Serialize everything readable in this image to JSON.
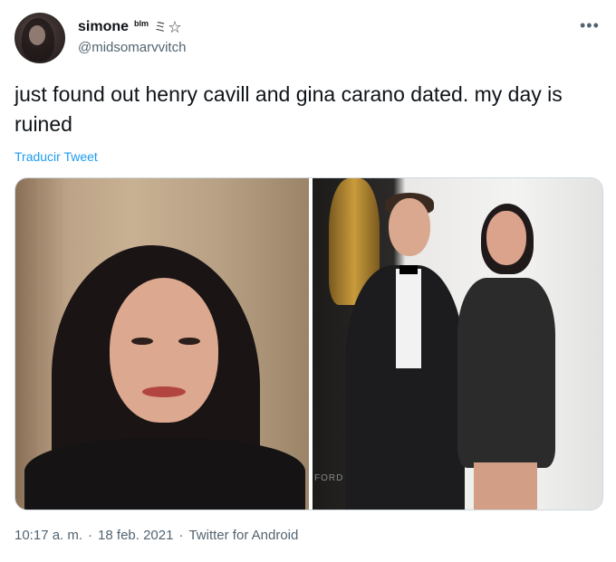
{
  "tweet": {
    "display_name": "simone",
    "name_extra": "blm",
    "name_emoji": "ミ☆",
    "handle": "@midsomarvvitch",
    "more_icon": "more-icon",
    "text": "just found out henry cavill and gina carano dated. my day is ruined",
    "translate_label": "Traducir Tweet",
    "time": "10:17 a. m.",
    "separator": "·",
    "date": "18 feb. 2021",
    "source": "Twitter for Android"
  },
  "media": {
    "right_photo_watermark": "FORD"
  },
  "colors": {
    "text": "#0f1419",
    "secondary": "#536471",
    "link": "#1d9bf0"
  }
}
